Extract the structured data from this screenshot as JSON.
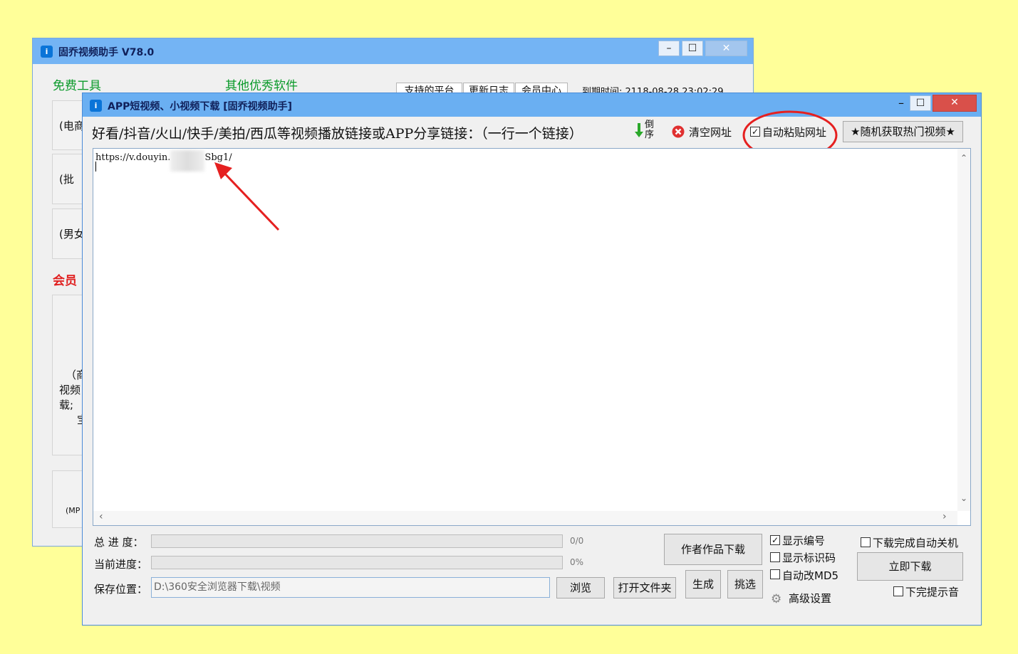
{
  "back_window": {
    "title": "固乔视频助手 V78.0",
    "min": "–",
    "max": "☐",
    "close": "✕",
    "free_tools": "免费工具",
    "other_software": "其他优秀软件",
    "tabs": [
      "支持的平台",
      "更新日志",
      "会员中心"
    ],
    "expire": "到期时间: 2118-08-28 23:02:29",
    "left_items": [
      "(电商",
      "(批",
      "(男女"
    ],
    "member_label": "会员",
    "big_panel_lines": [
      "（商",
      "视频",
      "载;",
      "宝"
    ],
    "bottom_item": "(MP"
  },
  "front_window": {
    "title": "APP短视频、小视频下载 [固乔视频助手]",
    "min": "–",
    "max": "☐",
    "close": "✕",
    "instruction": "好看/抖音/火山/快手/美拍/西瓜等视频播放链接或APP分享链接：（一行一个链接）",
    "reverse_label": "倒序",
    "clear_label": "清空网址",
    "auto_paste_label": "自动粘贴网址",
    "random_hot_label": "★随机获取热门视频★",
    "url_prefix": "https://v.douyin.",
    "url_suffix": "Sbg1/",
    "total_progress_label": "总 进 度：",
    "total_progress_value": "0/0",
    "current_progress_label": "当前进度：",
    "current_progress_value": "0%",
    "save_location_label": "保存位置：",
    "save_path": "D:\\360安全浏览器下载\\视频",
    "browse": "浏览",
    "open_folder": "打开文件夹",
    "author_download": "作者作品下载",
    "generate": "生成",
    "pick": "挑选",
    "show_number": "显示编号",
    "show_id_code": "显示标识码",
    "auto_md5": "自动改MD5",
    "advanced": "高级设置",
    "shutdown_after": "下载完成自动关机",
    "download_now": "立即下载",
    "done_sound": "下完提示音"
  },
  "colors": {
    "background": "#FFFF99",
    "title_bar": "#6aaff2",
    "close_button": "#d9504a",
    "annotation": "#e52020"
  }
}
